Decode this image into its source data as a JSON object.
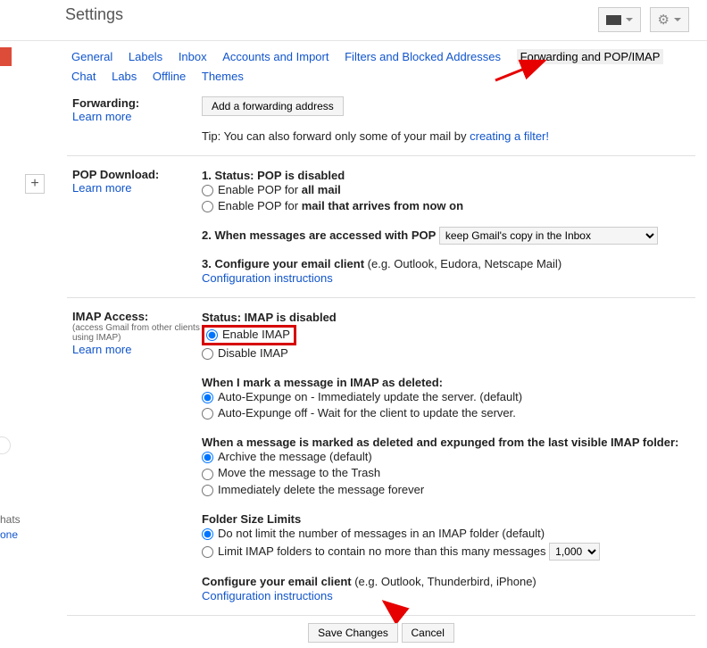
{
  "header": {
    "title": "Settings"
  },
  "tabs": {
    "general": "General",
    "labels": "Labels",
    "inbox": "Inbox",
    "accounts": "Accounts and Import",
    "filters": "Filters and Blocked Addresses",
    "forwarding": "Forwarding and POP/IMAP",
    "chat": "Chat",
    "labs": "Labs",
    "offline": "Offline",
    "themes": "Themes"
  },
  "forwarding_section": {
    "label": "Forwarding:",
    "learn_more": "Learn more",
    "add_btn": "Add a forwarding address",
    "tip_prefix": "Tip: You can also forward only some of your mail by ",
    "tip_link": "creating a filter!"
  },
  "pop_section": {
    "label": "POP Download:",
    "learn_more": "Learn more",
    "status_label": "1. Status: ",
    "status_value": "POP is disabled",
    "enable_all_prefix": "Enable POP for ",
    "enable_all_bold": "all mail",
    "enable_now_prefix": "Enable POP for ",
    "enable_now_bold": "mail that arrives from now on",
    "access_label": "2. When messages are accessed with POP",
    "access_option": "keep Gmail's copy in the Inbox",
    "configure_label": "3. Configure your email client ",
    "configure_eg": "(e.g. Outlook, Eudora, Netscape Mail)",
    "config_link": "Configuration instructions"
  },
  "imap_section": {
    "label": "IMAP Access:",
    "sub": "(access Gmail from other clients using IMAP)",
    "learn_more": "Learn more",
    "status_label": "Status: ",
    "status_value": "IMAP is disabled",
    "enable": "Enable IMAP",
    "disable": "Disable IMAP",
    "deleted_label": "When I mark a message in IMAP as deleted:",
    "expunge_on": "Auto-Expunge on - Immediately update the server. (default)",
    "expunge_off": "Auto-Expunge off - Wait for the client to update the server.",
    "expunged_label": "When a message is marked as deleted and expunged from the last visible IMAP folder:",
    "archive": "Archive the message (default)",
    "trash": "Move the message to the Trash",
    "delete": "Immediately delete the message forever",
    "folder_label": "Folder Size Limits",
    "no_limit": "Do not limit the number of messages in an IMAP folder (default)",
    "limit_prefix": "Limit IMAP folders to contain no more than this many messages",
    "limit_value": "1,000",
    "configure_label": "Configure your email client ",
    "configure_eg": "(e.g. Outlook, Thunderbird, iPhone)",
    "config_link": "Configuration instructions"
  },
  "footer": {
    "save": "Save Changes",
    "cancel": "Cancel"
  },
  "left": {
    "hats": "hats",
    "one": "one",
    "plus": "+"
  }
}
